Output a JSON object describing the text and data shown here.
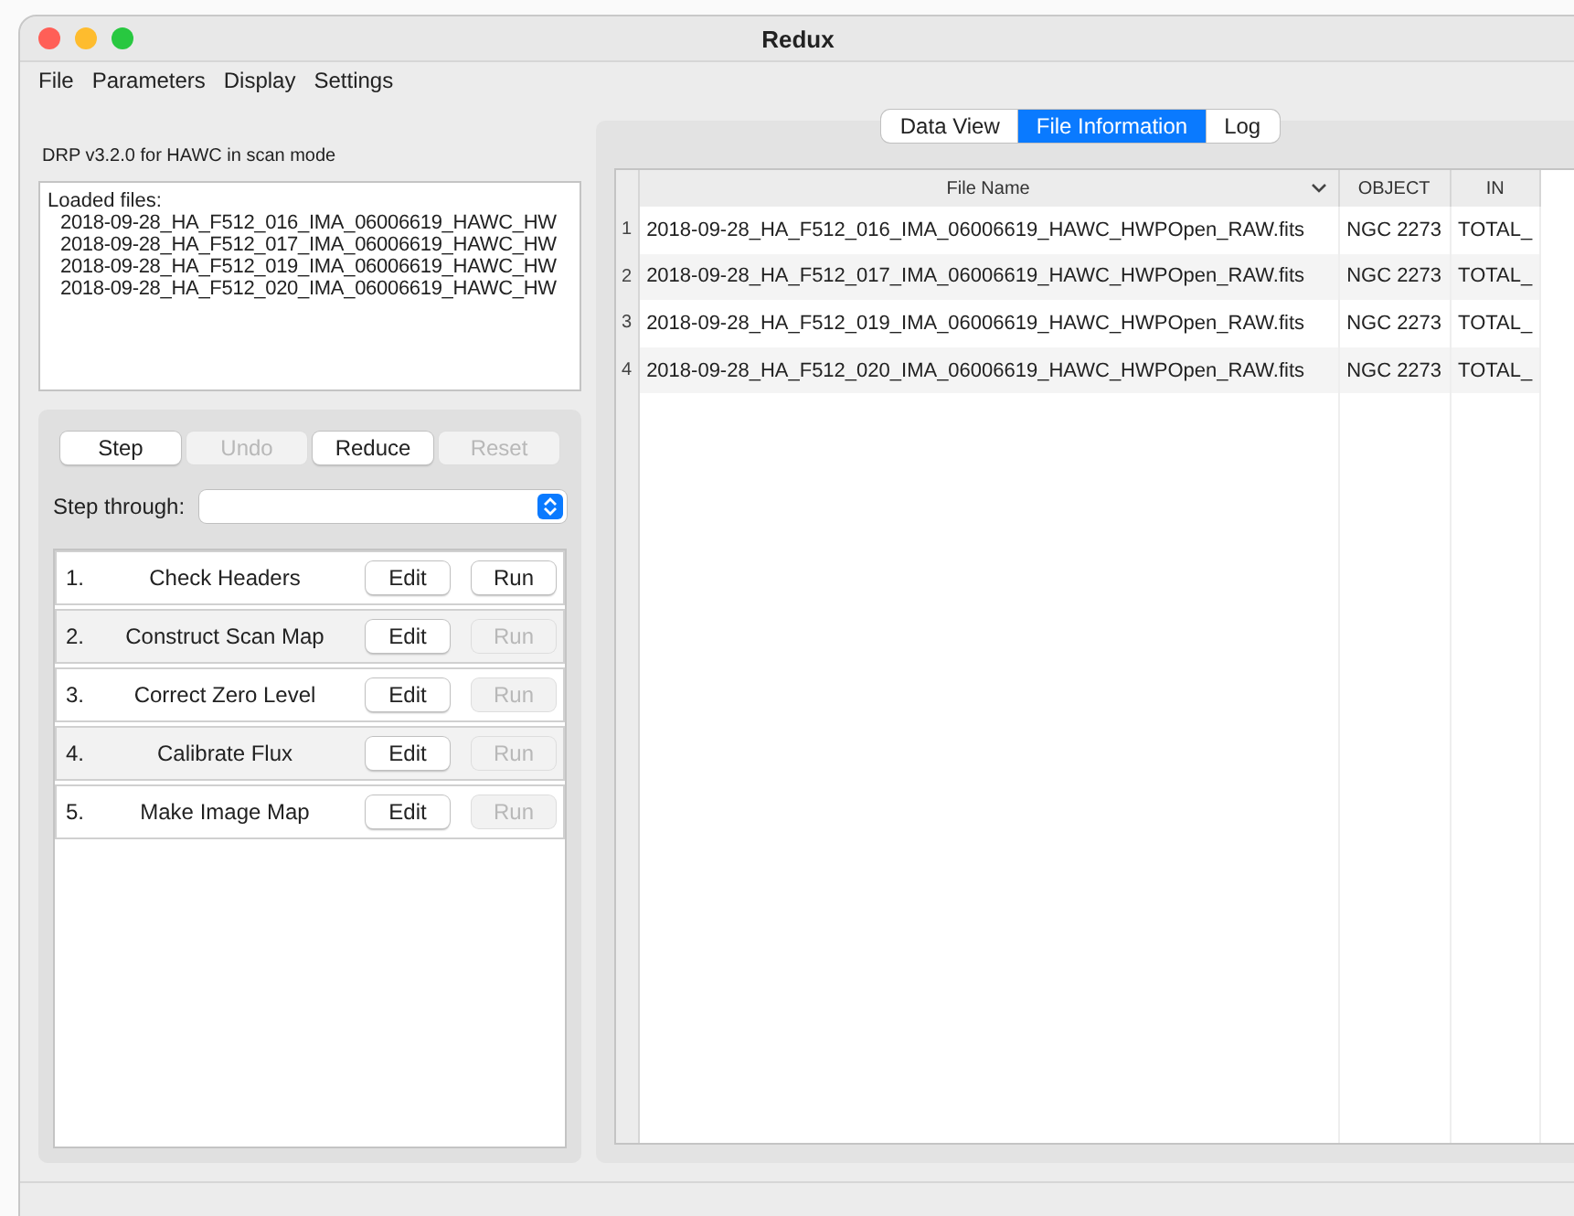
{
  "window": {
    "title": "Redux"
  },
  "menu": [
    "File",
    "Parameters",
    "Display",
    "Settings"
  ],
  "header": "DRP v3.2.0 for HAWC in scan mode",
  "loaded_files": {
    "label": "Loaded files:",
    "files": [
      "2018-09-28_HA_F512_016_IMA_06006619_HAWC_HW",
      "2018-09-28_HA_F512_017_IMA_06006619_HAWC_HW",
      "2018-09-28_HA_F512_019_IMA_06006619_HAWC_HW",
      "2018-09-28_HA_F512_020_IMA_06006619_HAWC_HW"
    ]
  },
  "controls": [
    {
      "label": "Step",
      "disabled": false
    },
    {
      "label": "Undo",
      "disabled": true
    },
    {
      "label": "Reduce",
      "disabled": false
    },
    {
      "label": "Reset",
      "disabled": true
    }
  ],
  "step_through": {
    "label": "Step through:"
  },
  "steps": [
    {
      "number": "1.",
      "name": "Check Headers",
      "edit": "Edit",
      "run": "Run",
      "run_disabled": false
    },
    {
      "number": "2.",
      "name": "Construct Scan Map",
      "edit": "Edit",
      "run": "Run",
      "run_disabled": true
    },
    {
      "number": "3.",
      "name": "Correct Zero Level",
      "edit": "Edit",
      "run": "Run",
      "run_disabled": true
    },
    {
      "number": "4.",
      "name": "Calibrate Flux",
      "edit": "Edit",
      "run": "Run",
      "run_disabled": true
    },
    {
      "number": "5.",
      "name": "Make Image Map",
      "edit": "Edit",
      "run": "Run",
      "run_disabled": true
    }
  ],
  "tabs": [
    {
      "label": "Data View",
      "selected": false
    },
    {
      "label": "File Information",
      "selected": true
    },
    {
      "label": "Log",
      "selected": false
    }
  ],
  "table": {
    "columns": [
      "File Name",
      "OBJECT",
      "IN"
    ],
    "rows": [
      {
        "index": "1",
        "cells": [
          "2018-09-28_HA_F512_016_IMA_06006619_HAWC_HWPOpen_RAW.fits",
          "NGC 2273",
          "TOTAL_"
        ]
      },
      {
        "index": "2",
        "cells": [
          "2018-09-28_HA_F512_017_IMA_06006619_HAWC_HWPOpen_RAW.fits",
          "NGC 2273",
          "TOTAL_"
        ]
      },
      {
        "index": "3",
        "cells": [
          "2018-09-28_HA_F512_019_IMA_06006619_HAWC_HWPOpen_RAW.fits",
          "NGC 2273",
          "TOTAL_"
        ]
      },
      {
        "index": "4",
        "cells": [
          "2018-09-28_HA_F512_020_IMA_06006619_HAWC_HWPOpen_RAW.fits",
          "NGC 2273",
          "TOTAL_"
        ]
      }
    ]
  }
}
